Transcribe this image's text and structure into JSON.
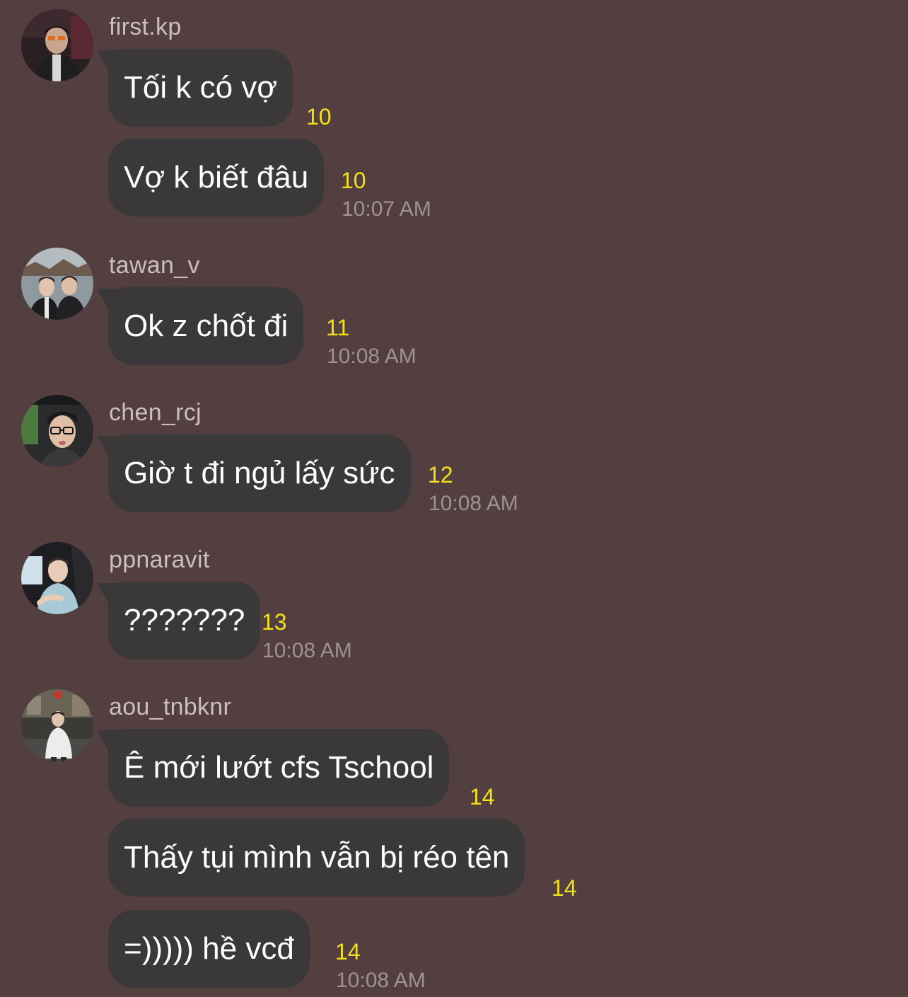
{
  "colors": {
    "background": "#533f40",
    "bubble": "#3a3839",
    "read_count": "#f4e11a",
    "timestamp": "#9e9293",
    "sender": "#cbbebe"
  },
  "messages": [
    {
      "sender": "first.kp",
      "avatar_icon": "user-avatar-first-kp",
      "bubbles": [
        {
          "text": "Tối k có vợ",
          "count": "10"
        },
        {
          "text": "Vợ k biết đâu",
          "count": "10",
          "time": "10:07 AM"
        }
      ]
    },
    {
      "sender": "tawan_v",
      "avatar_icon": "user-avatar-tawan-v",
      "bubbles": [
        {
          "text": "Ok z chốt đi",
          "count": "11",
          "time": "10:08 AM"
        }
      ]
    },
    {
      "sender": "chen_rcj",
      "avatar_icon": "user-avatar-chen-rcj",
      "bubbles": [
        {
          "text": "Giờ t đi ngủ lấy sức",
          "count": "12",
          "time": "10:08 AM"
        }
      ]
    },
    {
      "sender": "ppnaravit",
      "avatar_icon": "user-avatar-ppnaravit",
      "bubbles": [
        {
          "text": "???????",
          "count": "13",
          "time": "10:08 AM"
        }
      ]
    },
    {
      "sender": "aou_tnbknr",
      "avatar_icon": "user-avatar-aou-tnbknr",
      "bubbles": [
        {
          "text": "Ê mới lướt cfs Tschool",
          "count": "14"
        },
        {
          "text": "Thấy tụi mình vẫn bị réo tên",
          "count": "14"
        },
        {
          "text": "=))))) hề vcđ",
          "count": "14",
          "time": "10:08 AM"
        }
      ]
    }
  ]
}
